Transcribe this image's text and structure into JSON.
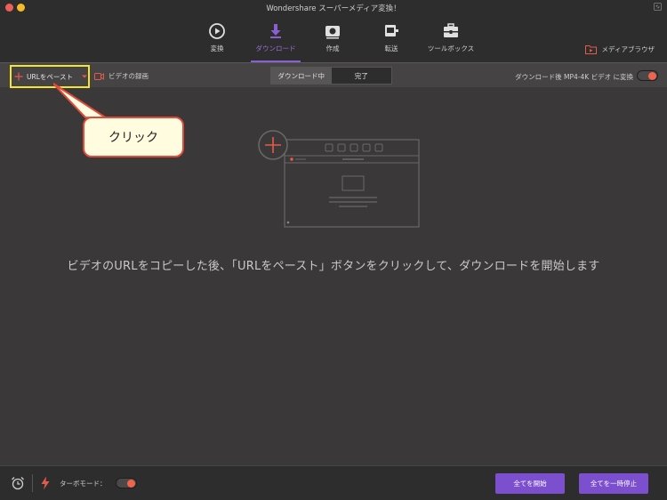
{
  "window": {
    "title": "Wondershare スーパーメディア変換！"
  },
  "nav": {
    "tabs": [
      {
        "label": "変換",
        "icon": "play-circle-icon"
      },
      {
        "label": "ダウンロード",
        "icon": "download-icon"
      },
      {
        "label": "作成",
        "icon": "disc-icon"
      },
      {
        "label": "転送",
        "icon": "transfer-icon"
      },
      {
        "label": "ツールボックス",
        "icon": "toolbox-icon"
      }
    ],
    "active_tab": "ダウンロード",
    "media_browser": "メディアブラウザ"
  },
  "toolbar": {
    "paste_url": "URLをペースト",
    "record_video": "ビデオの録画",
    "segments": [
      "ダウンロード中",
      "完了"
    ],
    "active_segment": "ダウンロード中",
    "convert_after": "ダウンロード後 MP4-4K ビデオ に変換",
    "convert_toggle_on": true
  },
  "callout": {
    "text": "クリック"
  },
  "main": {
    "instruction": "ビデオのURLをコピーした後、「URLをペースト」ボタンをクリックして、ダウンロードを開始します"
  },
  "bottom": {
    "turbo_label": "ターボモード：",
    "turbo_on": true,
    "start_all": "全てを開始",
    "pause_all": "全てを一時停止"
  },
  "colors": {
    "accent_purple": "#7c4fcf",
    "accent_orange": "#f0634c",
    "highlight_yellow": "#f2e437",
    "callout_border": "#e04b3c"
  }
}
